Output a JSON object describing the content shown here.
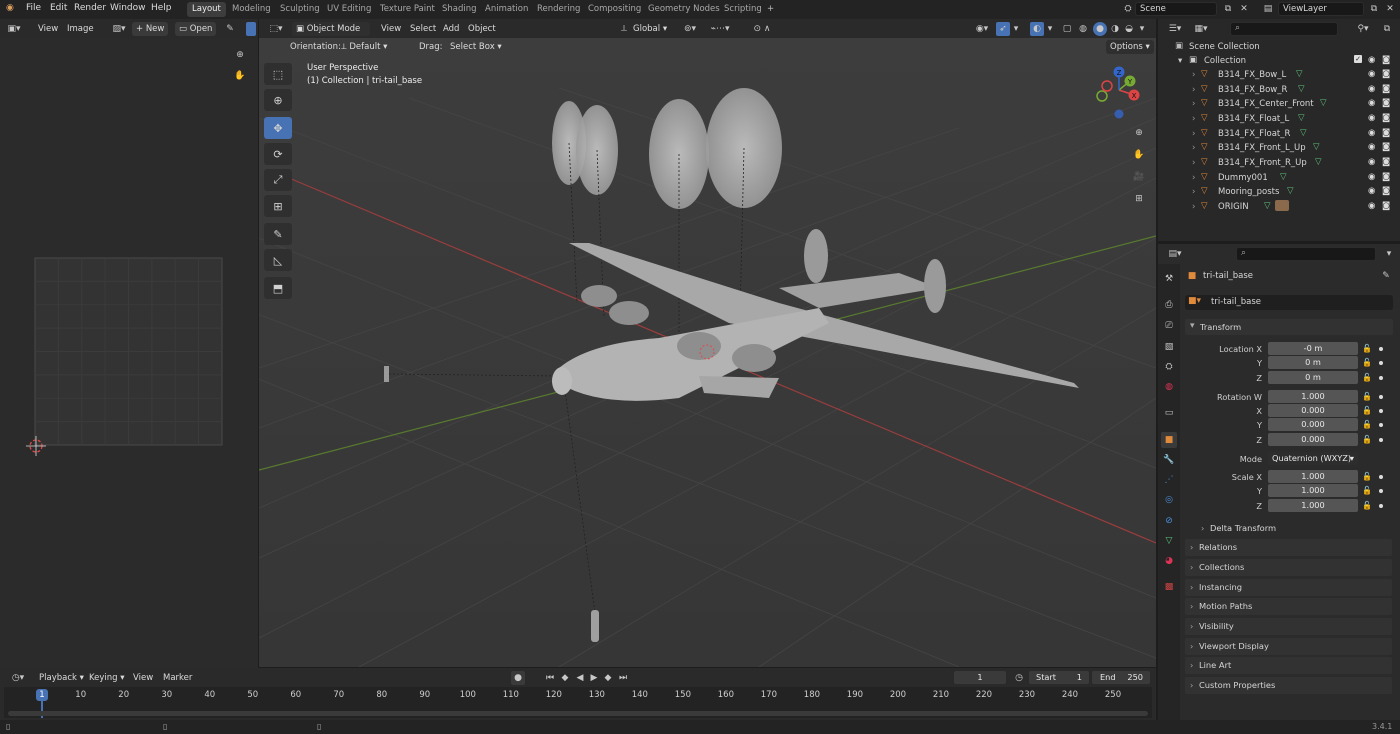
{
  "topbar": {
    "menus": [
      "File",
      "Edit",
      "Render",
      "Window",
      "Help"
    ],
    "workspaces": [
      "Layout",
      "Modeling",
      "Sculpting",
      "UV Editing",
      "Texture Paint",
      "Shading",
      "Animation",
      "Rendering",
      "Compositing",
      "Geometry Nodes",
      "Scripting"
    ],
    "active_workspace": "Layout",
    "add_tab": "+",
    "scene": "Scene",
    "view_layer": "ViewLayer"
  },
  "image_editor": {
    "menus": [
      "View",
      "Image"
    ],
    "new_label": "New",
    "open_label": "Open"
  },
  "viewport": {
    "mode": "Object Mode",
    "menus": [
      "View",
      "Select",
      "Add",
      "Object"
    ],
    "transform_orientation": "Global",
    "orientation_label": "Orientation:",
    "orientation_value": "Default",
    "drag_label": "Drag:",
    "drag_value": "Select Box",
    "options_label": "Options",
    "info_line1": "User Perspective",
    "info_line2": "(1) Collection | tri-tail_base",
    "gizmo_axes": [
      "X",
      "Y",
      "Z"
    ]
  },
  "outliner": {
    "scene_collection": "Scene Collection",
    "collection": "Collection",
    "items": [
      "B314_FX_Bow_L",
      "B314_FX_Bow_R",
      "B314_FX_Center_Front",
      "B314_FX_Float_L",
      "B314_FX_Float_R",
      "B314_FX_Front_L_Up",
      "B314_FX_Front_R_Up",
      "Dummy001",
      "Mooring_posts",
      "ORIGIN"
    ]
  },
  "properties": {
    "object_name": "tri-tail_base",
    "object_field": "tri-tail_base",
    "transform_header": "Transform",
    "location_x_label": "Location X",
    "location_x": "-0 m",
    "location_y": "0 m",
    "location_z": "0 m",
    "rotation_w_label": "Rotation W",
    "rotation_w": "1.000",
    "rotation_x": "0.000",
    "rotation_y": "0.000",
    "rotation_z": "0.000",
    "mode_label": "Mode",
    "mode_value": "Quaternion (WXYZ)",
    "scale_x_label": "Scale X",
    "scale_x": "1.000",
    "scale_y": "1.000",
    "scale_z": "1.000",
    "axis_x": "X",
    "axis_y": "Y",
    "axis_z": "Z",
    "delta_transform": "Delta Transform",
    "sections": [
      "Relations",
      "Collections",
      "Instancing",
      "Motion Paths",
      "Visibility",
      "Viewport Display",
      "Line Art",
      "Custom Properties"
    ]
  },
  "timeline": {
    "menus": [
      "Playback",
      "Keying",
      "View",
      "Marker"
    ],
    "current_frame": "1",
    "start_label": "Start",
    "start_value": "1",
    "end_label": "End",
    "end_value": "250",
    "ruler": [
      "1",
      "10",
      "20",
      "30",
      "40",
      "50",
      "60",
      "70",
      "80",
      "90",
      "100",
      "110",
      "120",
      "130",
      "140",
      "150",
      "160",
      "170",
      "180",
      "190",
      "200",
      "210",
      "220",
      "230",
      "240",
      "250"
    ]
  },
  "statusbar": {
    "version": "3.4.1"
  },
  "colors": {
    "accent": "#4772b3",
    "x_axis": "#b84848",
    "y_axis": "#6e9a3a",
    "object_orange": "#e08a3c",
    "mesh_green": "#5fc47a"
  }
}
